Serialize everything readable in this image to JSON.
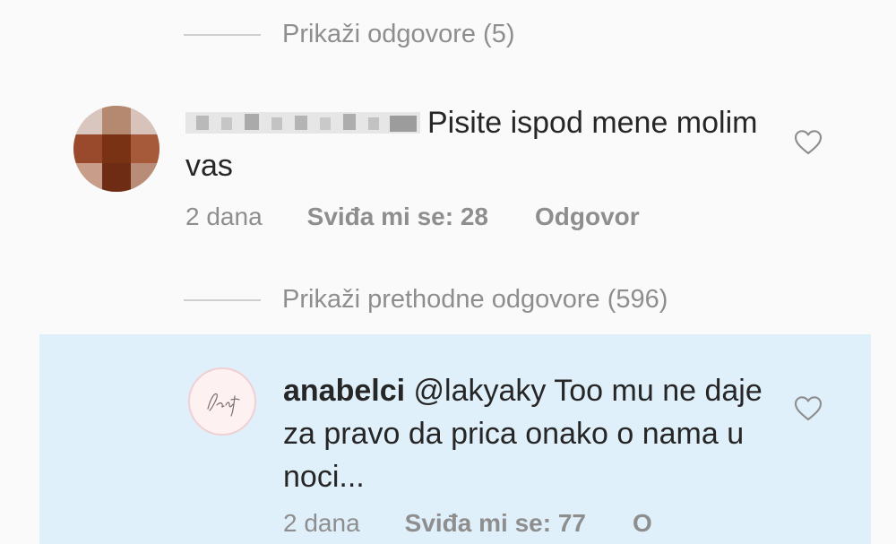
{
  "thread": {
    "view_replies_label": "Prikaži odgovore (5)",
    "view_previous_replies_label": "Prikaži prethodne odgovore (596)"
  },
  "comment_1": {
    "text": "Pisite ispod mene molim vas",
    "time": "2 dana",
    "likes": "Sviđa mi se: 28",
    "reply_label": "Odgovor"
  },
  "comment_2": {
    "username": "anabelci",
    "mention": "@lakyaky",
    "text": "Too mu ne daje za pravo da prica onako o nama u noci...",
    "time": "2 dana",
    "likes": "Sviđa mi se: 77",
    "reply_label": "O"
  },
  "icons": {
    "like": "heart-outline-icon"
  },
  "colors": {
    "highlight_background": "#e0f0fb",
    "secondary_text": "#8e8e8e"
  }
}
